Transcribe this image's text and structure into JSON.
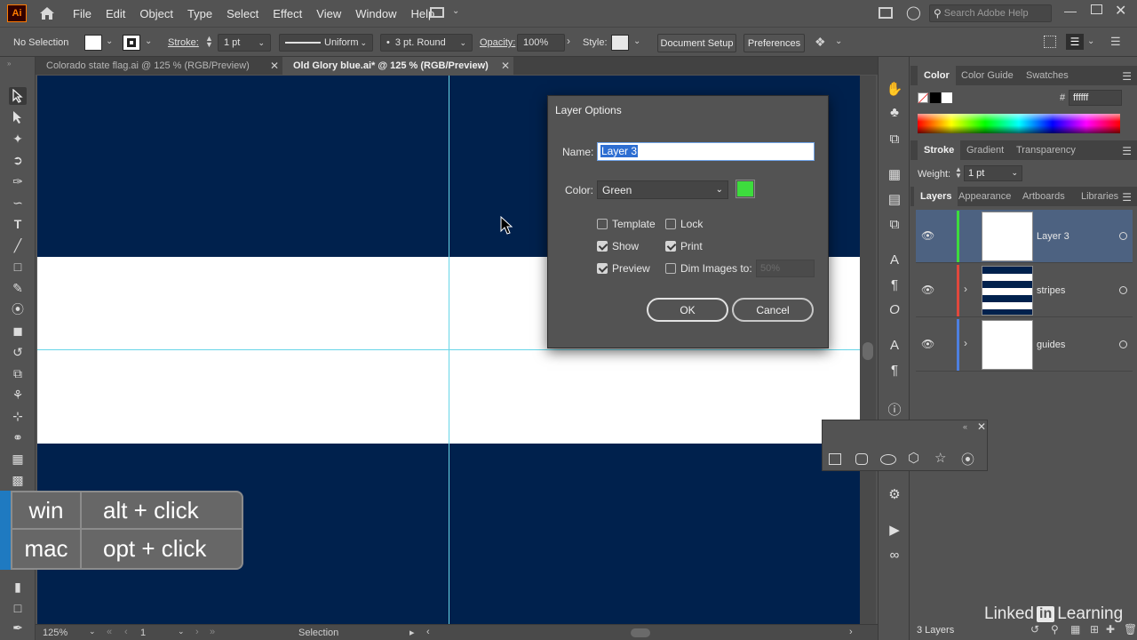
{
  "app": {
    "logo": "Ai",
    "search_placeholder": "Search Adobe Help"
  },
  "menu": [
    "File",
    "Edit",
    "Object",
    "Type",
    "Select",
    "Effect",
    "View",
    "Window",
    "Help"
  ],
  "control_bar": {
    "selection": "No Selection",
    "stroke_label": "Stroke:",
    "stroke_weight": "1 pt",
    "stroke_profile": "Uniform",
    "brush": "3 pt. Round",
    "opacity_label": "Opacity:",
    "opacity_value": "100%",
    "style_label": "Style:",
    "document_setup": "Document Setup",
    "preferences": "Preferences"
  },
  "tabs": [
    {
      "label": "Colorado state flag.ai @ 125 % (RGB/Preview)",
      "active": false
    },
    {
      "label": "Old Glory blue.ai* @ 125 % (RGB/Preview)",
      "active": true
    }
  ],
  "dialog": {
    "title": "Layer Options",
    "name_label": "Name:",
    "name_value": "Layer 3",
    "color_label": "Color:",
    "color_value": "Green",
    "color_swatch": "#3ddc3d",
    "checkboxes": {
      "template": {
        "label": "Template",
        "checked": false
      },
      "lock": {
        "label": "Lock",
        "checked": false
      },
      "show": {
        "label": "Show",
        "checked": true
      },
      "print": {
        "label": "Print",
        "checked": true
      },
      "preview": {
        "label": "Preview",
        "checked": true
      },
      "dim": {
        "label": "Dim Images to:",
        "checked": false
      }
    },
    "dim_value": "50%",
    "ok": "OK",
    "cancel": "Cancel"
  },
  "shortcut": {
    "win_key": "win",
    "win_action": "alt + click",
    "mac_key": "mac",
    "mac_action": "opt + click"
  },
  "panels": {
    "color_tabs": [
      "Color",
      "Color Guide",
      "Swatches"
    ],
    "hex_label": "#",
    "hex_value": "ffffff",
    "stroke_tabs": [
      "Stroke",
      "Gradient",
      "Transparency"
    ],
    "weight_label": "Weight:",
    "weight_value": "1 pt",
    "layer_tabs": [
      "Layers",
      "Appearance",
      "Artboards",
      "Libraries"
    ],
    "layers": [
      {
        "name": "Layer 3",
        "color": "#3ddc3d",
        "selected": true
      },
      {
        "name": "stripes",
        "color": "#e0483c",
        "selected": false
      },
      {
        "name": "guides",
        "color": "#4d7fe0",
        "selected": false
      }
    ],
    "layer_count": "3 Layers"
  },
  "status": {
    "zoom": "125%",
    "artboard": "1",
    "tool": "Selection"
  },
  "watermark": {
    "left": "Linked",
    "in": "in",
    "right": "Learning"
  },
  "colors": {
    "canvas_blue": "#00214d",
    "guide": "#67d6e8",
    "accent": "#ff7c00"
  }
}
